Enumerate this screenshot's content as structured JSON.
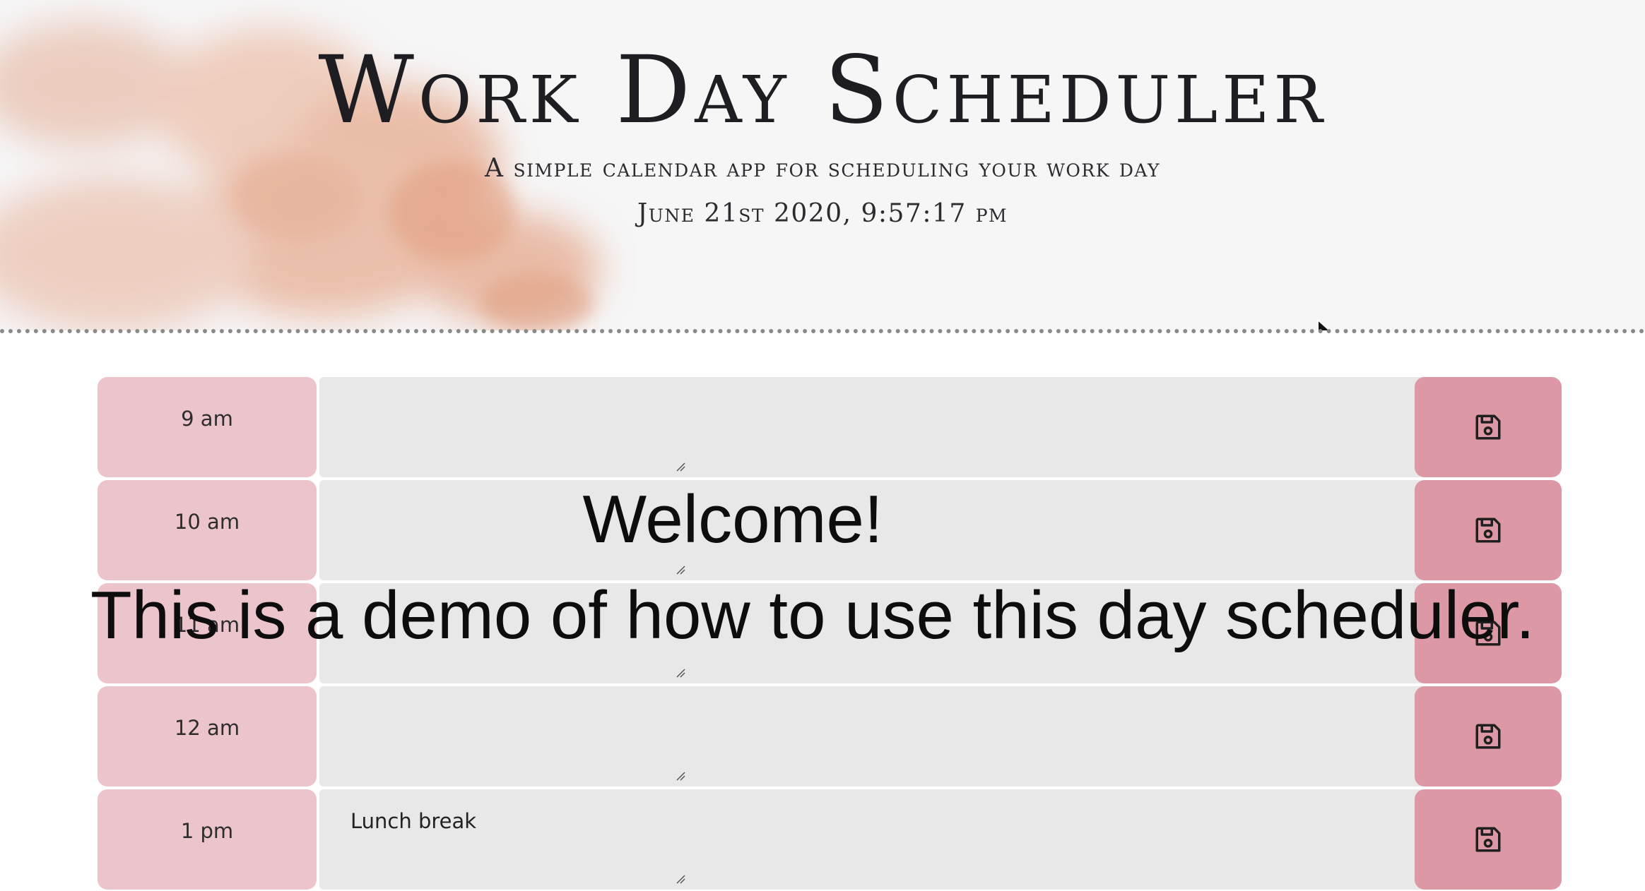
{
  "header": {
    "title": "Work Day Scheduler",
    "subtitle": "A simple calendar app for scheduling your work day",
    "current_datetime": "June 21st 2020, 9:57:17 pm"
  },
  "schedule": {
    "rows": [
      {
        "hour": "9 am",
        "description": ""
      },
      {
        "hour": "10 am",
        "description": ""
      },
      {
        "hour": "11 am",
        "description": ""
      },
      {
        "hour": "12 am",
        "description": ""
      },
      {
        "hour": "1 pm",
        "description": "Lunch break"
      }
    ],
    "save_icon": "floppy-disk-icon"
  },
  "overlay": {
    "line1": "Welcome!",
    "line2": "This is a demo of how to use this day scheduler."
  },
  "colors": {
    "hour_block": "#ecc4cb",
    "description_block": "#e8e8e8",
    "save_button": "#dd98a6",
    "header_background": "#f6f6f7",
    "watercolor": "#e2a58c"
  }
}
